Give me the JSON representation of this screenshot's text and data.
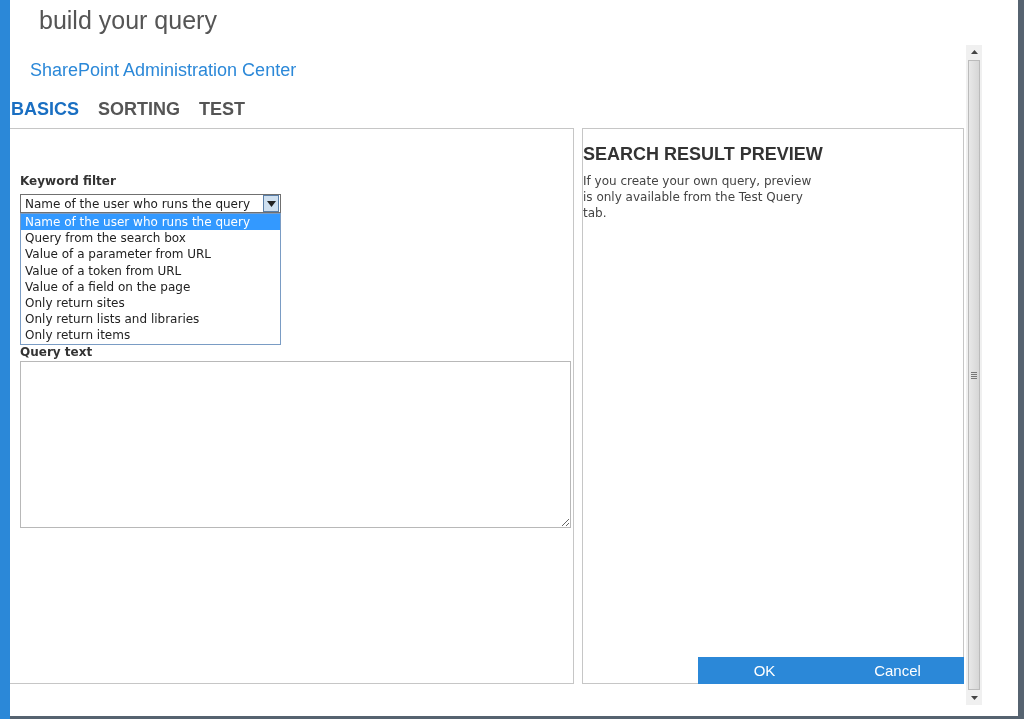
{
  "dialog": {
    "title": "build your query",
    "subtitle": "SharePoint Administration Center"
  },
  "tabs": [
    {
      "label": "BASICS",
      "selected": true
    },
    {
      "label": "SORTING",
      "selected": false
    },
    {
      "label": "TEST",
      "selected": false
    }
  ],
  "keyword_filter": {
    "label": "Keyword filter",
    "value": "Name of the user who runs the query",
    "expanded": true,
    "options": [
      {
        "label": "Name of the user who runs the query",
        "selected": true
      },
      {
        "label": "Query from the search box",
        "selected": false
      },
      {
        "label": "Value of a parameter from URL",
        "selected": false
      },
      {
        "label": "Value of a token from URL",
        "selected": false
      },
      {
        "label": "Value of a field on the page",
        "selected": false
      },
      {
        "label": "Only return sites",
        "selected": false
      },
      {
        "label": "Only return lists and libraries",
        "selected": false
      },
      {
        "label": "Only return items",
        "selected": false
      }
    ]
  },
  "query_text": {
    "label": "Query text"
  },
  "preview": {
    "title": "SEARCH RESULT PREVIEW",
    "text": "If you create your own query, preview is only available from the Test Query tab."
  },
  "buttons": [
    "OK",
    "Cancel"
  ]
}
